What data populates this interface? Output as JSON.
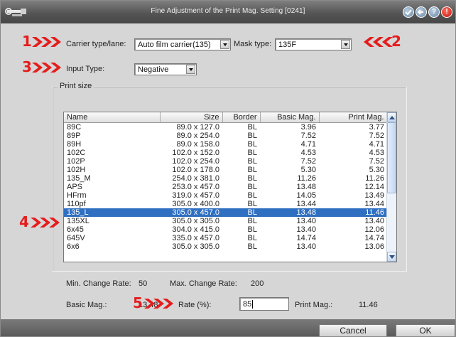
{
  "window": {
    "title": "Fine Adjustment of the Print Mag. Setting [0241]"
  },
  "titlebar_buttons": [
    {
      "icon": "check-icon"
    },
    {
      "icon": "back-icon"
    },
    {
      "icon": "help-icon",
      "glyph": "?"
    },
    {
      "icon": "alert-icon",
      "glyph": "!"
    }
  ],
  "markers": [
    "1",
    "2",
    "3",
    "4",
    "5"
  ],
  "carrier": {
    "label": "Carrier type/lane:",
    "value": "Auto film carrier(135)"
  },
  "mask": {
    "label": "Mask type:",
    "value": "135F"
  },
  "input_type": {
    "label": "Input Type:",
    "value": "Negative"
  },
  "print_size": {
    "title": "Print size",
    "columns": [
      "Name",
      "Size",
      "Border",
      "Basic Mag.",
      "Print Mag."
    ],
    "rows": [
      [
        "89C",
        "89.0 x 127.0",
        "BL",
        "3.96",
        "3.77"
      ],
      [
        "89P",
        "89.0 x 254.0",
        "BL",
        "7.52",
        "7.52"
      ],
      [
        "89H",
        "89.0 x 158.0",
        "BL",
        "4.71",
        "4.71"
      ],
      [
        "102C",
        "102.0 x 152.0",
        "BL",
        "4.53",
        "4.53"
      ],
      [
        "102P",
        "102.0 x 254.0",
        "BL",
        "7.52",
        "7.52"
      ],
      [
        "102H",
        "102.0 x 178.0",
        "BL",
        "5.30",
        "5.30"
      ],
      [
        "135_M",
        "254.0 x 381.0",
        "BL",
        "11.26",
        "11.26"
      ],
      [
        "APS",
        "253.0 x 457.0",
        "BL",
        "13.48",
        "12.14"
      ],
      [
        "HFrm",
        "319.0 x 457.0",
        "BL",
        "14.05",
        "13.49"
      ],
      [
        "110pf",
        "305.0 x 400.0",
        "BL",
        "13.44",
        "13.44"
      ],
      [
        "135_L",
        "305.0 x 457.0",
        "BL",
        "13.48",
        "11.46"
      ],
      [
        "135XL",
        "305.0 x 305.0",
        "BL",
        "13.40",
        "13.40"
      ],
      [
        "6x45",
        "304.0 x 415.0",
        "BL",
        "13.40",
        "12.06"
      ],
      [
        "645V",
        "335.0 x 457.0",
        "BL",
        "14.74",
        "14.74"
      ],
      [
        "6x6",
        "305.0 x 305.0",
        "BL",
        "13.40",
        "13.06"
      ]
    ],
    "selected_index": 10
  },
  "rates": {
    "min_label": "Min. Change Rate:",
    "min_value": "50",
    "max_label": "Max. Change Rate:",
    "max_value": "200"
  },
  "adjust": {
    "basic_label": "Basic Mag.:",
    "basic_value": "13.48",
    "rate_label": "Rate (%):",
    "rate_value": "85",
    "print_label": "Print Mag.:",
    "print_value": "11.46"
  },
  "buttons": {
    "cancel": "Cancel",
    "ok": "OK"
  }
}
